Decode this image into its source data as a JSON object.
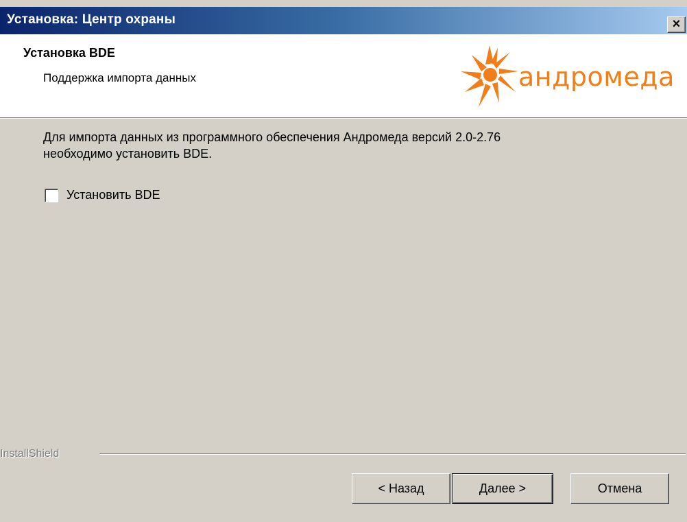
{
  "window": {
    "title": "Установка: Центр охраны",
    "close_label": "×"
  },
  "header": {
    "title": "Установка BDE",
    "subtitle": "Поддержка импорта данных",
    "logo_text": "андромеда",
    "logo_color": "#f07e1a"
  },
  "body": {
    "description_line1": "Для импорта данных из программного обеспечения Андромеда версий 2.0-2.76",
    "description_line2": "необходимо установить BDE.",
    "checkbox": {
      "label": "Установить BDE",
      "checked": false
    }
  },
  "footer": {
    "brand": "InstallShield",
    "buttons": {
      "back": "< Назад",
      "next": "Далее >",
      "cancel": "Отмена"
    }
  }
}
